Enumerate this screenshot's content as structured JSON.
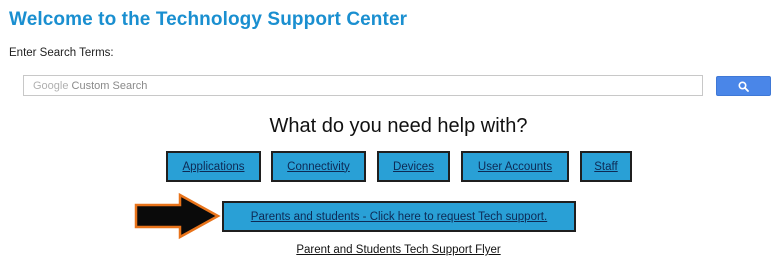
{
  "page": {
    "title": "Welcome to the Technology Support Center"
  },
  "search": {
    "label": "Enter Search Terms:",
    "placeholder_brand": "Google",
    "placeholder_text": "Custom Search",
    "button_icon": "search-icon"
  },
  "help": {
    "heading": "What do you need help with?",
    "categories": [
      {
        "label": "Applications"
      },
      {
        "label": "Connectivity"
      },
      {
        "label": "Devices"
      },
      {
        "label": "User Accounts"
      },
      {
        "label": "Staff"
      }
    ],
    "request_label": "Parents and students - Click here to request Tech support.",
    "flyer_label": "Parent and Students Tech Support Flyer"
  },
  "colors": {
    "title": "#1a8fd0",
    "button_fill": "#29a0d6",
    "search_button": "#4a86e8",
    "arrow_outline": "#e8731a"
  }
}
